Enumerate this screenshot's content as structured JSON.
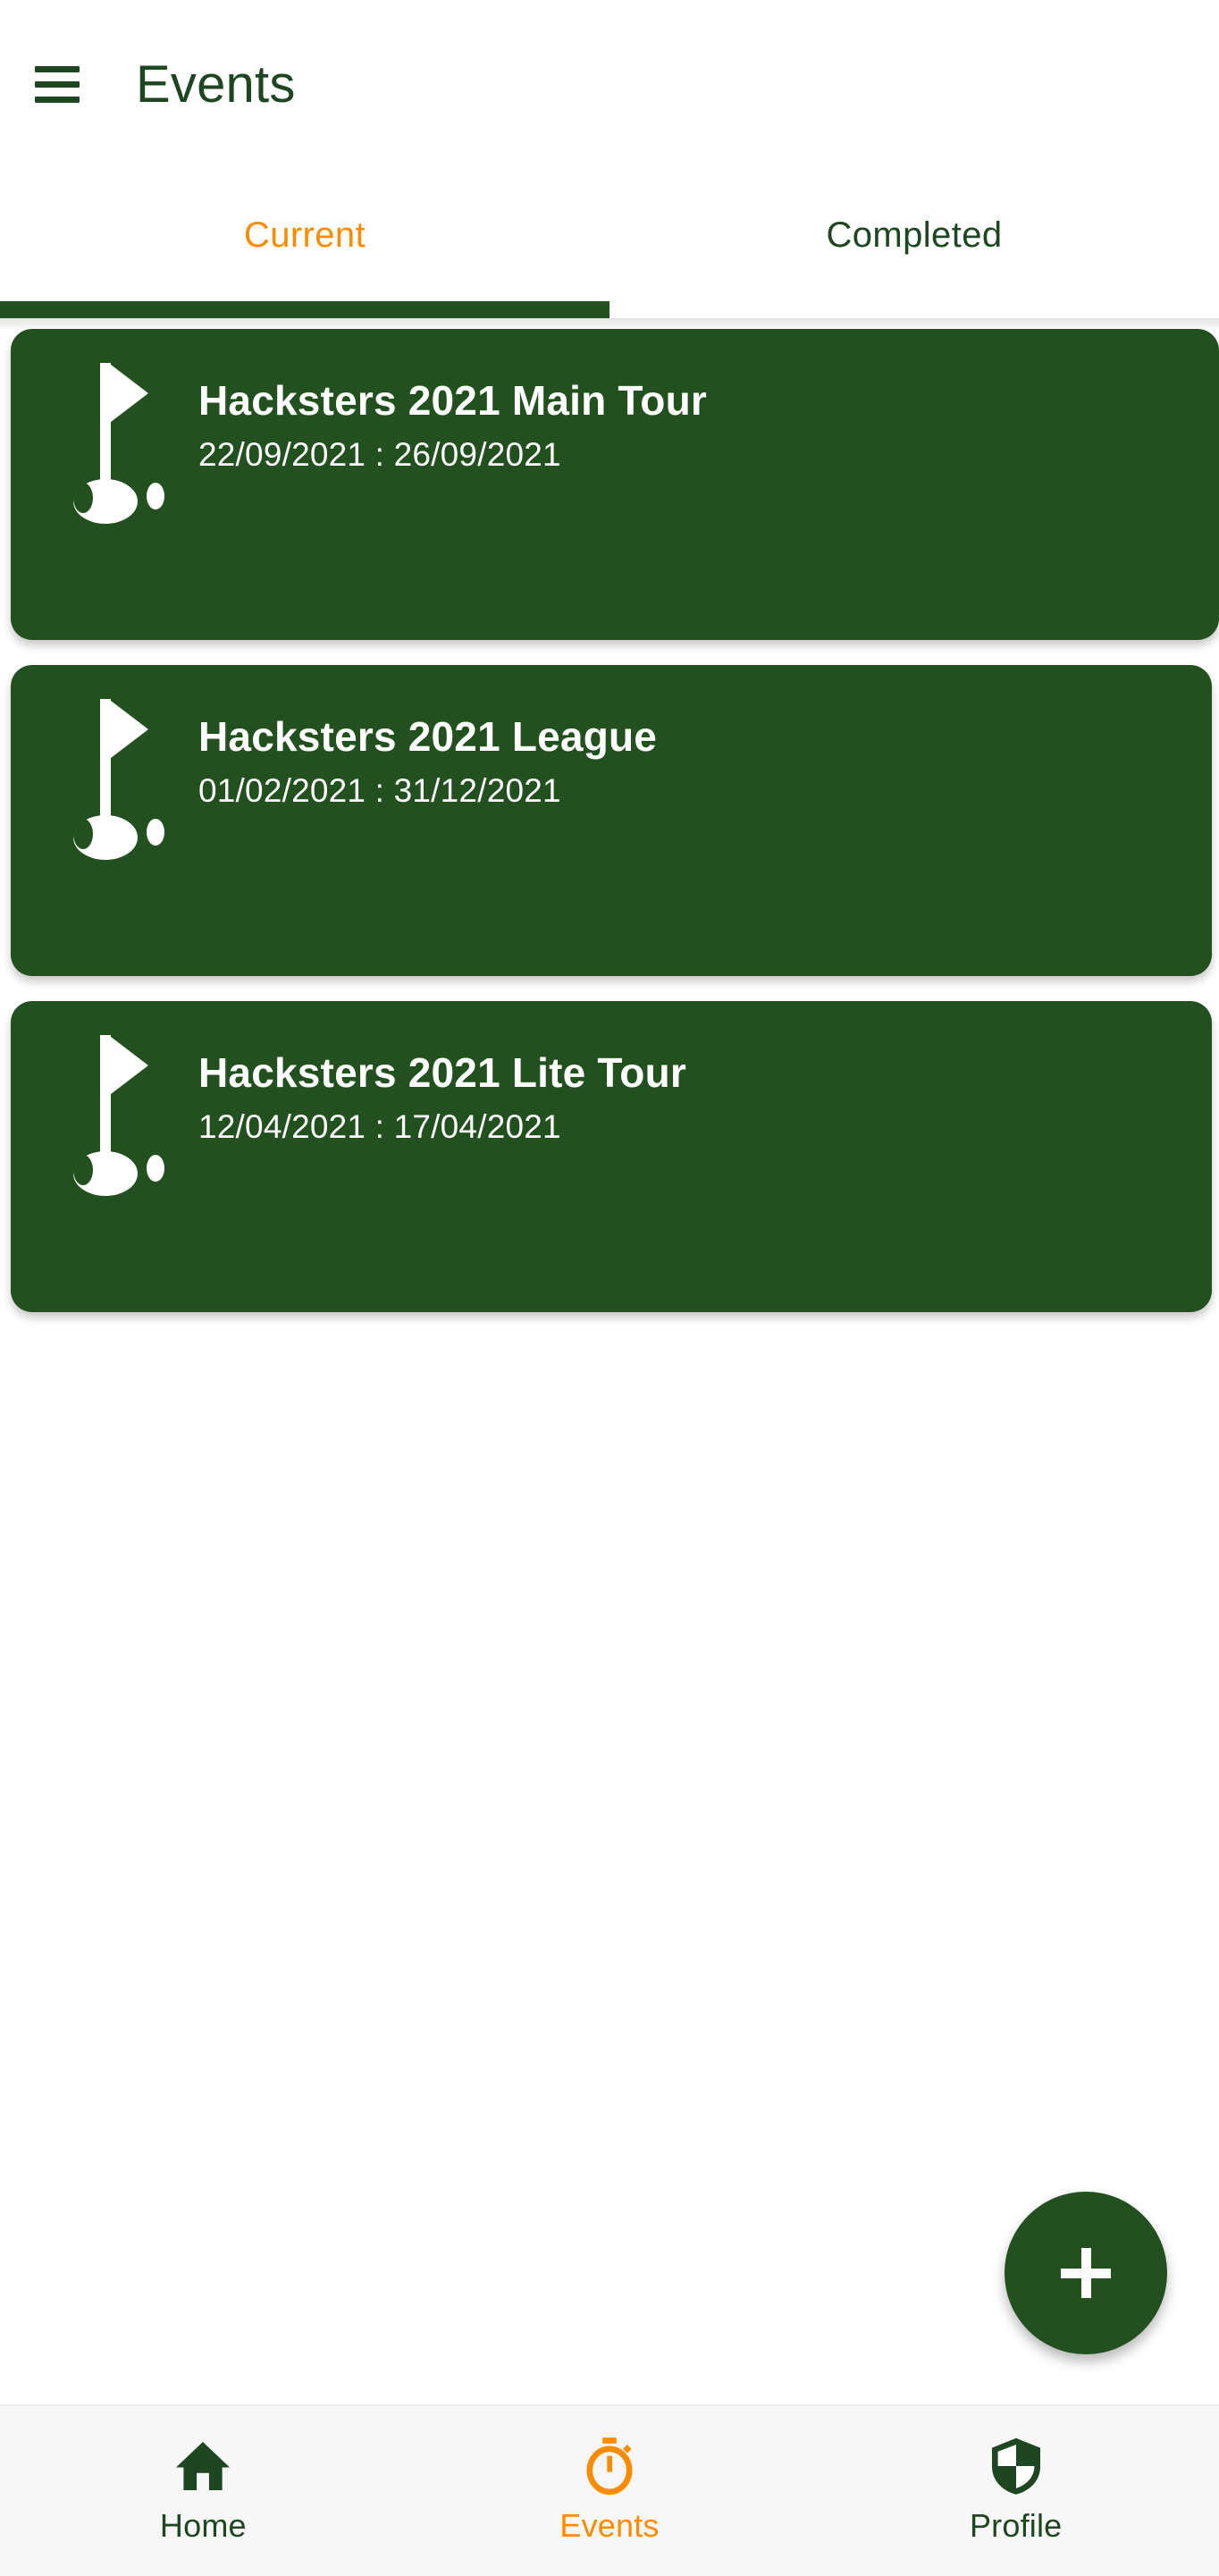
{
  "app": {
    "title": "Events",
    "menu_icon": "hamburger-menu-icon"
  },
  "tabs": {
    "items": [
      {
        "label": "Current",
        "active": true
      },
      {
        "label": "Completed",
        "active": false
      }
    ]
  },
  "events": {
    "items": [
      {
        "title": "Hacksters 2021 Main Tour",
        "dates": "22/09/2021 : 26/09/2021",
        "icon": "golf-flag-icon"
      },
      {
        "title": "Hacksters 2021 League",
        "dates": "01/02/2021 : 31/12/2021",
        "icon": "golf-flag-icon"
      },
      {
        "title": "Hacksters 2021 Lite Tour",
        "dates": "12/04/2021 : 17/04/2021",
        "icon": "golf-flag-icon"
      }
    ]
  },
  "fab": {
    "icon": "plus-icon",
    "label": "+"
  },
  "bottom_nav": {
    "items": [
      {
        "label": "Home",
        "icon": "home-icon",
        "active": false
      },
      {
        "label": "Events",
        "icon": "stopwatch-icon",
        "active": true
      },
      {
        "label": "Profile",
        "icon": "shield-icon",
        "active": false
      }
    ]
  },
  "colors": {
    "brand_green": "#23501F",
    "title_green": "#1E4620",
    "accent_orange": "#FB8C00",
    "card_text": "#FFFFFF",
    "page_background": "#FFFFFF",
    "nav_background": "#F7F7F7"
  }
}
